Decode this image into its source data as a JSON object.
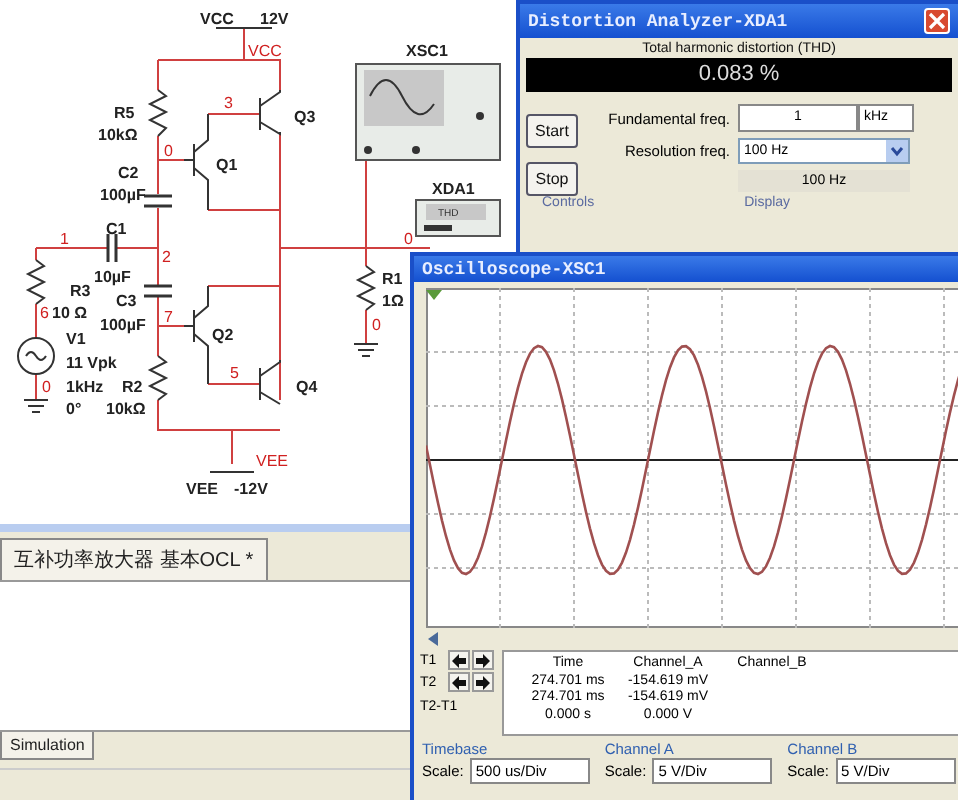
{
  "schematic": {
    "labels": [
      {
        "text": "VCC",
        "kind": "part"
      },
      {
        "text": "12V",
        "kind": "part"
      },
      {
        "text": "VCC",
        "kind": "net"
      },
      {
        "text": "R5",
        "kind": "part"
      },
      {
        "text": "10kΩ",
        "kind": "part"
      },
      {
        "text": "3",
        "kind": "net"
      },
      {
        "text": "Q3",
        "kind": "part"
      },
      {
        "text": "C2",
        "kind": "part"
      },
      {
        "text": "0",
        "kind": "net"
      },
      {
        "text": "Q1",
        "kind": "part"
      },
      {
        "text": "100µF",
        "kind": "part"
      },
      {
        "text": "1",
        "kind": "net"
      },
      {
        "text": "C1",
        "kind": "part"
      },
      {
        "text": "2",
        "kind": "net"
      },
      {
        "text": "10µF",
        "kind": "part"
      },
      {
        "text": "R3",
        "kind": "part"
      },
      {
        "text": "6",
        "kind": "net"
      },
      {
        "text": "10 Ω",
        "kind": "part"
      },
      {
        "text": "C3",
        "kind": "part"
      },
      {
        "text": "100µF",
        "kind": "part"
      },
      {
        "text": "7",
        "kind": "net"
      },
      {
        "text": "Q2",
        "kind": "part"
      },
      {
        "text": "V1",
        "kind": "part"
      },
      {
        "text": "11 Vpk",
        "kind": "part"
      },
      {
        "text": "0",
        "kind": "net"
      },
      {
        "text": "1kHz",
        "kind": "part"
      },
      {
        "text": "R2",
        "kind": "part"
      },
      {
        "text": "0°",
        "kind": "part"
      },
      {
        "text": "10kΩ",
        "kind": "part"
      },
      {
        "text": "5",
        "kind": "net"
      },
      {
        "text": "Q4",
        "kind": "part"
      },
      {
        "text": "VEE",
        "kind": "net"
      },
      {
        "text": "VEE",
        "kind": "part"
      },
      {
        "text": "-12V",
        "kind": "part"
      },
      {
        "text": "XSC1",
        "kind": "part"
      },
      {
        "text": "XDA1",
        "kind": "part"
      },
      {
        "text": "R1",
        "kind": "part"
      },
      {
        "text": "1Ω",
        "kind": "part"
      },
      {
        "text": "0",
        "kind": "net"
      },
      {
        "text": "0",
        "kind": "net"
      },
      {
        "text": "THD",
        "kind": "tiny"
      }
    ]
  },
  "main_window": {
    "tabs": [
      {
        "label": "互补功率放大器 基本OCL *",
        "selected": true
      }
    ],
    "bottom_tabs": [
      {
        "label": "Simulation",
        "selected": true
      }
    ]
  },
  "distortion_analyzer": {
    "title": "Distortion Analyzer-XDA1",
    "thd_label": "Total harmonic distortion (THD)",
    "thd_value": "0.083 %",
    "buttons": [
      "Start",
      "Stop"
    ],
    "fundamental_freq": {
      "label": "Fundamental freq.",
      "value": "1",
      "unit": "kHz"
    },
    "resolution_freq": {
      "label": "Resolution freq.",
      "value": "100 Hz",
      "display": "100 Hz"
    },
    "groups": [
      "Controls",
      "Display"
    ]
  },
  "oscilloscope": {
    "title": "Oscilloscope-XSC1",
    "cursors": [
      "T1",
      "T2"
    ],
    "difference_label": "T2-T1",
    "readout": {
      "columns": [
        "Time",
        "Channel_A",
        "Channel_B"
      ],
      "rows": [
        [
          "274.701 ms",
          "-154.619 mV"
        ],
        [
          "274.701 ms",
          "-154.619 mV"
        ],
        [
          "0.000 s",
          "0.000 V"
        ]
      ]
    },
    "settings": [
      {
        "group": "Timebase",
        "label": "Scale:",
        "value": "500 us/Div"
      },
      {
        "group": "Channel A",
        "label": "Scale:",
        "value": "5  V/Div"
      },
      {
        "group": "Channel B",
        "label": "Scale:",
        "value": "5  V/Div"
      }
    ]
  }
}
